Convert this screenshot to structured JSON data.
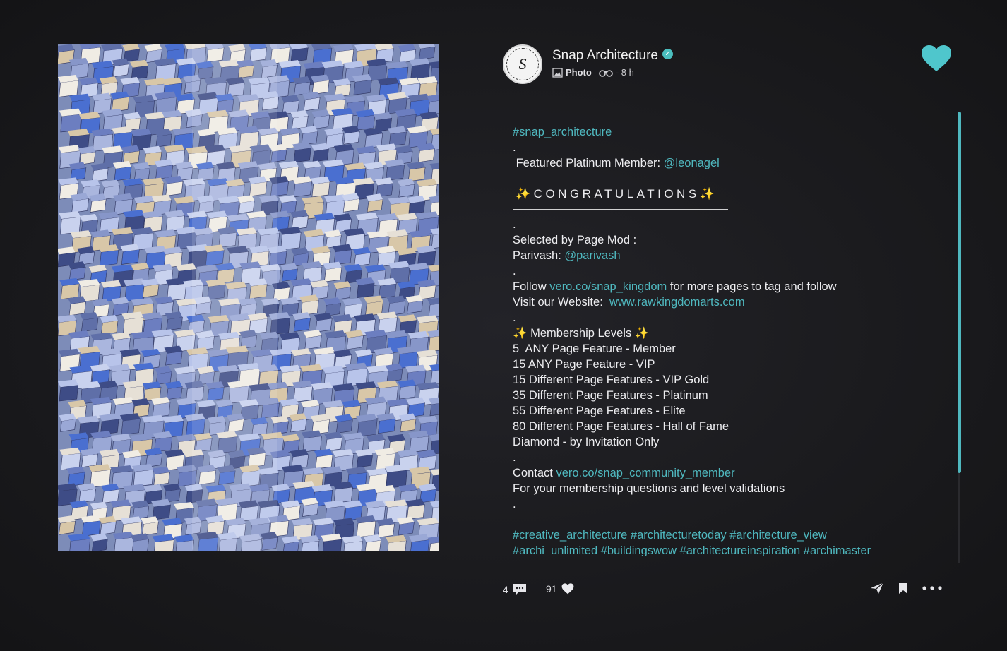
{
  "post": {
    "author": "Snap Architecture",
    "avatar_letter": "S",
    "type_label": "Photo",
    "time": "- 8 h",
    "accent": "#4fb8bf"
  },
  "caption": {
    "hashtag_top": "#snap_architecture",
    "dot": ".",
    "featured_prefix": " Featured Platinum Member: ",
    "featured_handle": "@leonagel",
    "congrats": "✨CONGRATULATIONS✨",
    "selected_by": "Selected by Page Mod :",
    "mod_prefix": "Parivash: ",
    "mod_handle": "@parivash",
    "follow_prefix": "Follow ",
    "follow_link": "vero.co/snap_kingdom",
    "follow_suffix": " for more pages to tag and follow",
    "website_prefix": "Visit our Website:  ",
    "website_link": "www.rawkingdomarts.com",
    "levels_title": "✨ Membership Levels ✨",
    "levels": [
      "5  ANY Page Feature - Member",
      "15 ANY Page Feature - VIP",
      "15 Different Page Features - VIP Gold",
      "35 Different Page Features - Platinum",
      "55 Different Page Features - Elite",
      "80 Different Page Features - Hall of Fame",
      "Diamond - by Invitation Only"
    ],
    "contact_prefix": "Contact ",
    "contact_link": "vero.co/snap_community_member",
    "contact_note": "For your membership questions and level validations",
    "tags_line1": "#creative_architecture #architecturetoday #architecture_view",
    "tags_line2": "#archi_unlimited #buildingswow #architectureinspiration #archimaster"
  },
  "footer": {
    "comments": "4",
    "likes": "91"
  }
}
